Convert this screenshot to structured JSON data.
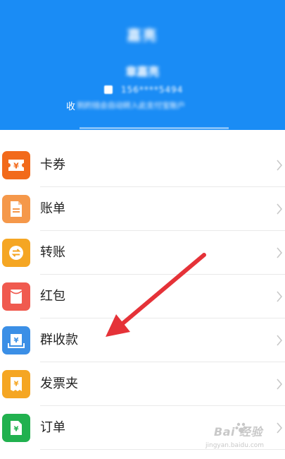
{
  "header": {
    "title": "嘉亮",
    "name": "章嘉亮",
    "phone": "156****5494",
    "note_prefix": "收",
    "note_blur": "到的钱会自动转入此支付宝账户",
    "bg_color": "#1a8cf5"
  },
  "menu": {
    "items": [
      {
        "label": "卡券",
        "icon": "ticket-yuan-icon",
        "color": "#f26a1b"
      },
      {
        "label": "账单",
        "icon": "bill-document-icon",
        "color": "#f5984a"
      },
      {
        "label": "转账",
        "icon": "transfer-arrows-icon",
        "color": "#f5a623"
      },
      {
        "label": "红包",
        "icon": "red-envelope-icon",
        "color": "#f05a4f"
      },
      {
        "label": "群收款",
        "icon": "group-collect-yuan-icon",
        "color": "#3b8fe6"
      },
      {
        "label": "发票夹",
        "icon": "invoice-yuan-icon",
        "color": "#f5a623"
      },
      {
        "label": "订单",
        "icon": "order-yuan-icon",
        "color": "#21b14f"
      }
    ]
  },
  "annotation": {
    "arrow_color": "#e53238"
  },
  "watermark": {
    "brand": "Bai 经验",
    "sub": "经验",
    "url": "jingyan.baidu.com"
  }
}
